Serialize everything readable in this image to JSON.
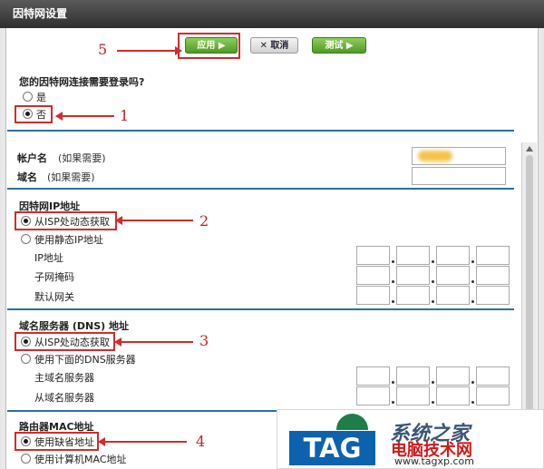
{
  "window": {
    "title": "因特网设置"
  },
  "toolbar": {
    "apply_label": "应用 ▶",
    "cancel_label": "✕ 取消",
    "test_label": "测试 ▶"
  },
  "login": {
    "question": "您的因特网连接需要登录吗?",
    "yes_label": "是",
    "no_label": "否",
    "selected": "no"
  },
  "account": {
    "username_label": "帐户名",
    "username_note": "(如果需要)",
    "domain_label": "域名",
    "domain_note": "(如果需要)"
  },
  "internet_ip": {
    "section_title": "因特网IP地址",
    "dynamic_label": "从ISP处动态获取",
    "static_label": "使用静态IP地址",
    "selected": "dynamic",
    "ip_label": "IP地址",
    "subnet_label": "子网掩码",
    "gateway_label": "默认网关"
  },
  "dns": {
    "section_title": "域名服务器 (DNS) 地址",
    "dynamic_label": "从ISP处动态获取",
    "manual_label": "使用下面的DNS服务器",
    "selected": "dynamic",
    "primary_label": "主域名服务器",
    "secondary_label": "从域名服务器"
  },
  "mac": {
    "section_title": "路由器MAC地址",
    "default_label": "使用缺省地址",
    "computer_label": "使用计算机MAC地址",
    "selected": "default"
  },
  "annotations": {
    "n1": "1",
    "n2": "2",
    "n3": "3",
    "n4": "4",
    "n5": "5"
  },
  "watermark": {
    "tag": "TAG",
    "name": "电脑技术网",
    "url": "www.tagxp.com",
    "site_mark": "系统之家"
  },
  "colors": {
    "title_bar": "#2f2f2f",
    "accent": "#2e6f9f",
    "apply": "#4f9a25",
    "callout": "#d32b2b"
  },
  "icons": {
    "scroll_up": "triangle-up-icon",
    "watermark_globe": "globe-icon"
  }
}
